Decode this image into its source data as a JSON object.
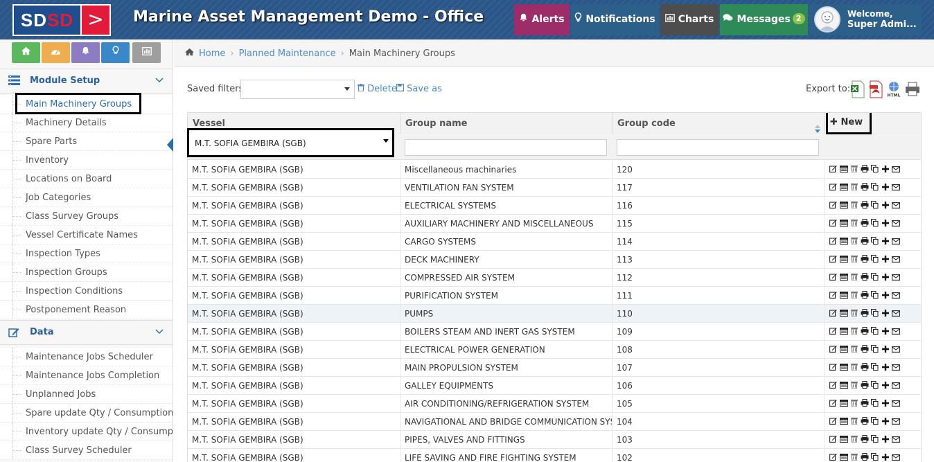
{
  "header": {
    "logo_text_a": "SD",
    "logo_text_b": "SD",
    "title": "Marine Asset Management Demo - Office",
    "alerts_label": "Alerts",
    "notifications_label": "Notifications",
    "charts_label": "Charts",
    "messages_label": "Messages",
    "messages_badge": "2",
    "welcome": "Welcome,",
    "user_name": "Super Admi..."
  },
  "sidebar": {
    "section1": {
      "title": "Module Setup",
      "items": [
        "Main Machinery Groups",
        "Machinery Details",
        "Spare Parts",
        "Inventory",
        "Locations on Board",
        "Job Categories",
        "Class Survey Groups",
        "Vessel Certificate Names",
        "Inspection Types",
        "Inspection Groups",
        "Inspection Conditions",
        "Postponement Reason"
      ]
    },
    "section2": {
      "title": "Data",
      "items": [
        "Maintenance Jobs Scheduler",
        "Maintenance Jobs Completion",
        "Unplanned Jobs",
        "Spare update Qty / Consumption",
        "Inventory update Qty / Consumption",
        "Class Survey Scheduler"
      ]
    }
  },
  "breadcrumb": {
    "home": "Home",
    "parent": "Planned Maintenance",
    "current": "Main Machinery Groups"
  },
  "filters": {
    "saved_filters_label": "Saved filters",
    "saved_filter_value": "",
    "delete_label": "Delete",
    "saveas_label": "Save as",
    "export_label": "Export to:"
  },
  "grid": {
    "columns": {
      "vessel": "Vessel",
      "group_name": "Group name",
      "group_code": "Group code",
      "new_label": "New"
    },
    "vessel_filter_value": "M.T. SOFIA GEMBIRA (SGB)",
    "group_name_filter": "",
    "group_code_filter": "",
    "rows": [
      {
        "vessel": "M.T. SOFIA GEMBIRA (SGB)",
        "name": "Miscellaneous machinaries",
        "code": "120"
      },
      {
        "vessel": "M.T. SOFIA GEMBIRA (SGB)",
        "name": "VENTILATION FAN SYSTEM",
        "code": "117"
      },
      {
        "vessel": "M.T. SOFIA GEMBIRA (SGB)",
        "name": "ELECTRICAL SYSTEMS",
        "code": "116"
      },
      {
        "vessel": "M.T. SOFIA GEMBIRA (SGB)",
        "name": "AUXILIARY MACHINERY AND MISCELLANEOUS",
        "code": "115"
      },
      {
        "vessel": "M.T. SOFIA GEMBIRA (SGB)",
        "name": "CARGO SYSTEMS",
        "code": "114"
      },
      {
        "vessel": "M.T. SOFIA GEMBIRA (SGB)",
        "name": "DECK MACHINERY",
        "code": "113"
      },
      {
        "vessel": "M.T. SOFIA GEMBIRA (SGB)",
        "name": "COMPRESSED AIR SYSTEM",
        "code": "112"
      },
      {
        "vessel": "M.T. SOFIA GEMBIRA (SGB)",
        "name": "PURIFICATION SYSTEM",
        "code": "111"
      },
      {
        "vessel": "M.T. SOFIA GEMBIRA (SGB)",
        "name": "PUMPS",
        "code": "110"
      },
      {
        "vessel": "M.T. SOFIA GEMBIRA (SGB)",
        "name": "BOILERS STEAM AND INERT GAS SYSTEM",
        "code": "109"
      },
      {
        "vessel": "M.T. SOFIA GEMBIRA (SGB)",
        "name": "ELECTRICAL POWER GENERATION",
        "code": "108"
      },
      {
        "vessel": "M.T. SOFIA GEMBIRA (SGB)",
        "name": "MAIN PROPULSION SYSTEM",
        "code": "107"
      },
      {
        "vessel": "M.T. SOFIA GEMBIRA (SGB)",
        "name": "GALLEY EQUIPMENTS",
        "code": "106"
      },
      {
        "vessel": "M.T. SOFIA GEMBIRA (SGB)",
        "name": "AIR CONDITIONING/REFRIGERATION SYSTEM",
        "code": "105"
      },
      {
        "vessel": "M.T. SOFIA GEMBIRA (SGB)",
        "name": "NAVIGATIONAL AND BRIDGE COMMUNICATION SYSTEM",
        "code": "104"
      },
      {
        "vessel": "M.T. SOFIA GEMBIRA (SGB)",
        "name": "PIPES, VALVES AND FITTINGS",
        "code": "103"
      },
      {
        "vessel": "M.T. SOFIA GEMBIRA (SGB)",
        "name": "LIFE SAVING AND FIRE FIGHTING SYSTEM",
        "code": "102"
      }
    ],
    "highlighted_row": 8,
    "row_actions": [
      "edit-icon",
      "details-icon",
      "delete-icon",
      "print-icon",
      "copy-icon",
      "add-icon",
      "email-icon"
    ]
  },
  "colors": {
    "header_bg": "#2a5689",
    "alerts": "#9c2d69",
    "notifications": "#2c5f8a",
    "charts": "#4d4d4d",
    "messages": "#2e8a57",
    "link": "#4c8bc7",
    "shortcut_home": "#5cb85c",
    "shortcut_dashboard": "#f0ad4e",
    "shortcut_alerts": "#8e7cc3",
    "shortcut_notifications": "#3a87c9",
    "shortcut_charts": "#9e9e9e"
  }
}
